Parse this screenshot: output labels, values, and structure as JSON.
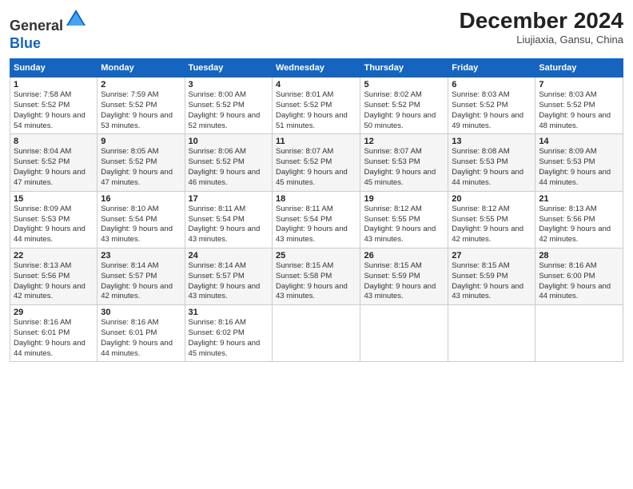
{
  "header": {
    "logo_line1": "General",
    "logo_line2": "Blue",
    "month_title": "December 2024",
    "location": "Liujiaxia, Gansu, China"
  },
  "days_of_week": [
    "Sunday",
    "Monday",
    "Tuesday",
    "Wednesday",
    "Thursday",
    "Friday",
    "Saturday"
  ],
  "weeks": [
    [
      {
        "day": "1",
        "sunrise": "Sunrise: 7:58 AM",
        "sunset": "Sunset: 5:52 PM",
        "daylight": "Daylight: 9 hours and 54 minutes."
      },
      {
        "day": "2",
        "sunrise": "Sunrise: 7:59 AM",
        "sunset": "Sunset: 5:52 PM",
        "daylight": "Daylight: 9 hours and 53 minutes."
      },
      {
        "day": "3",
        "sunrise": "Sunrise: 8:00 AM",
        "sunset": "Sunset: 5:52 PM",
        "daylight": "Daylight: 9 hours and 52 minutes."
      },
      {
        "day": "4",
        "sunrise": "Sunrise: 8:01 AM",
        "sunset": "Sunset: 5:52 PM",
        "daylight": "Daylight: 9 hours and 51 minutes."
      },
      {
        "day": "5",
        "sunrise": "Sunrise: 8:02 AM",
        "sunset": "Sunset: 5:52 PM",
        "daylight": "Daylight: 9 hours and 50 minutes."
      },
      {
        "day": "6",
        "sunrise": "Sunrise: 8:03 AM",
        "sunset": "Sunset: 5:52 PM",
        "daylight": "Daylight: 9 hours and 49 minutes."
      },
      {
        "day": "7",
        "sunrise": "Sunrise: 8:03 AM",
        "sunset": "Sunset: 5:52 PM",
        "daylight": "Daylight: 9 hours and 48 minutes."
      }
    ],
    [
      {
        "day": "8",
        "sunrise": "Sunrise: 8:04 AM",
        "sunset": "Sunset: 5:52 PM",
        "daylight": "Daylight: 9 hours and 47 minutes."
      },
      {
        "day": "9",
        "sunrise": "Sunrise: 8:05 AM",
        "sunset": "Sunset: 5:52 PM",
        "daylight": "Daylight: 9 hours and 47 minutes."
      },
      {
        "day": "10",
        "sunrise": "Sunrise: 8:06 AM",
        "sunset": "Sunset: 5:52 PM",
        "daylight": "Daylight: 9 hours and 46 minutes."
      },
      {
        "day": "11",
        "sunrise": "Sunrise: 8:07 AM",
        "sunset": "Sunset: 5:52 PM",
        "daylight": "Daylight: 9 hours and 45 minutes."
      },
      {
        "day": "12",
        "sunrise": "Sunrise: 8:07 AM",
        "sunset": "Sunset: 5:53 PM",
        "daylight": "Daylight: 9 hours and 45 minutes."
      },
      {
        "day": "13",
        "sunrise": "Sunrise: 8:08 AM",
        "sunset": "Sunset: 5:53 PM",
        "daylight": "Daylight: 9 hours and 44 minutes."
      },
      {
        "day": "14",
        "sunrise": "Sunrise: 8:09 AM",
        "sunset": "Sunset: 5:53 PM",
        "daylight": "Daylight: 9 hours and 44 minutes."
      }
    ],
    [
      {
        "day": "15",
        "sunrise": "Sunrise: 8:09 AM",
        "sunset": "Sunset: 5:53 PM",
        "daylight": "Daylight: 9 hours and 44 minutes."
      },
      {
        "day": "16",
        "sunrise": "Sunrise: 8:10 AM",
        "sunset": "Sunset: 5:54 PM",
        "daylight": "Daylight: 9 hours and 43 minutes."
      },
      {
        "day": "17",
        "sunrise": "Sunrise: 8:11 AM",
        "sunset": "Sunset: 5:54 PM",
        "daylight": "Daylight: 9 hours and 43 minutes."
      },
      {
        "day": "18",
        "sunrise": "Sunrise: 8:11 AM",
        "sunset": "Sunset: 5:54 PM",
        "daylight": "Daylight: 9 hours and 43 minutes."
      },
      {
        "day": "19",
        "sunrise": "Sunrise: 8:12 AM",
        "sunset": "Sunset: 5:55 PM",
        "daylight": "Daylight: 9 hours and 43 minutes."
      },
      {
        "day": "20",
        "sunrise": "Sunrise: 8:12 AM",
        "sunset": "Sunset: 5:55 PM",
        "daylight": "Daylight: 9 hours and 42 minutes."
      },
      {
        "day": "21",
        "sunrise": "Sunrise: 8:13 AM",
        "sunset": "Sunset: 5:56 PM",
        "daylight": "Daylight: 9 hours and 42 minutes."
      }
    ],
    [
      {
        "day": "22",
        "sunrise": "Sunrise: 8:13 AM",
        "sunset": "Sunset: 5:56 PM",
        "daylight": "Daylight: 9 hours and 42 minutes."
      },
      {
        "day": "23",
        "sunrise": "Sunrise: 8:14 AM",
        "sunset": "Sunset: 5:57 PM",
        "daylight": "Daylight: 9 hours and 42 minutes."
      },
      {
        "day": "24",
        "sunrise": "Sunrise: 8:14 AM",
        "sunset": "Sunset: 5:57 PM",
        "daylight": "Daylight: 9 hours and 43 minutes."
      },
      {
        "day": "25",
        "sunrise": "Sunrise: 8:15 AM",
        "sunset": "Sunset: 5:58 PM",
        "daylight": "Daylight: 9 hours and 43 minutes."
      },
      {
        "day": "26",
        "sunrise": "Sunrise: 8:15 AM",
        "sunset": "Sunset: 5:59 PM",
        "daylight": "Daylight: 9 hours and 43 minutes."
      },
      {
        "day": "27",
        "sunrise": "Sunrise: 8:15 AM",
        "sunset": "Sunset: 5:59 PM",
        "daylight": "Daylight: 9 hours and 43 minutes."
      },
      {
        "day": "28",
        "sunrise": "Sunrise: 8:16 AM",
        "sunset": "Sunset: 6:00 PM",
        "daylight": "Daylight: 9 hours and 44 minutes."
      }
    ],
    [
      {
        "day": "29",
        "sunrise": "Sunrise: 8:16 AM",
        "sunset": "Sunset: 6:01 PM",
        "daylight": "Daylight: 9 hours and 44 minutes."
      },
      {
        "day": "30",
        "sunrise": "Sunrise: 8:16 AM",
        "sunset": "Sunset: 6:01 PM",
        "daylight": "Daylight: 9 hours and 44 minutes."
      },
      {
        "day": "31",
        "sunrise": "Sunrise: 8:16 AM",
        "sunset": "Sunset: 6:02 PM",
        "daylight": "Daylight: 9 hours and 45 minutes."
      },
      null,
      null,
      null,
      null
    ]
  ]
}
